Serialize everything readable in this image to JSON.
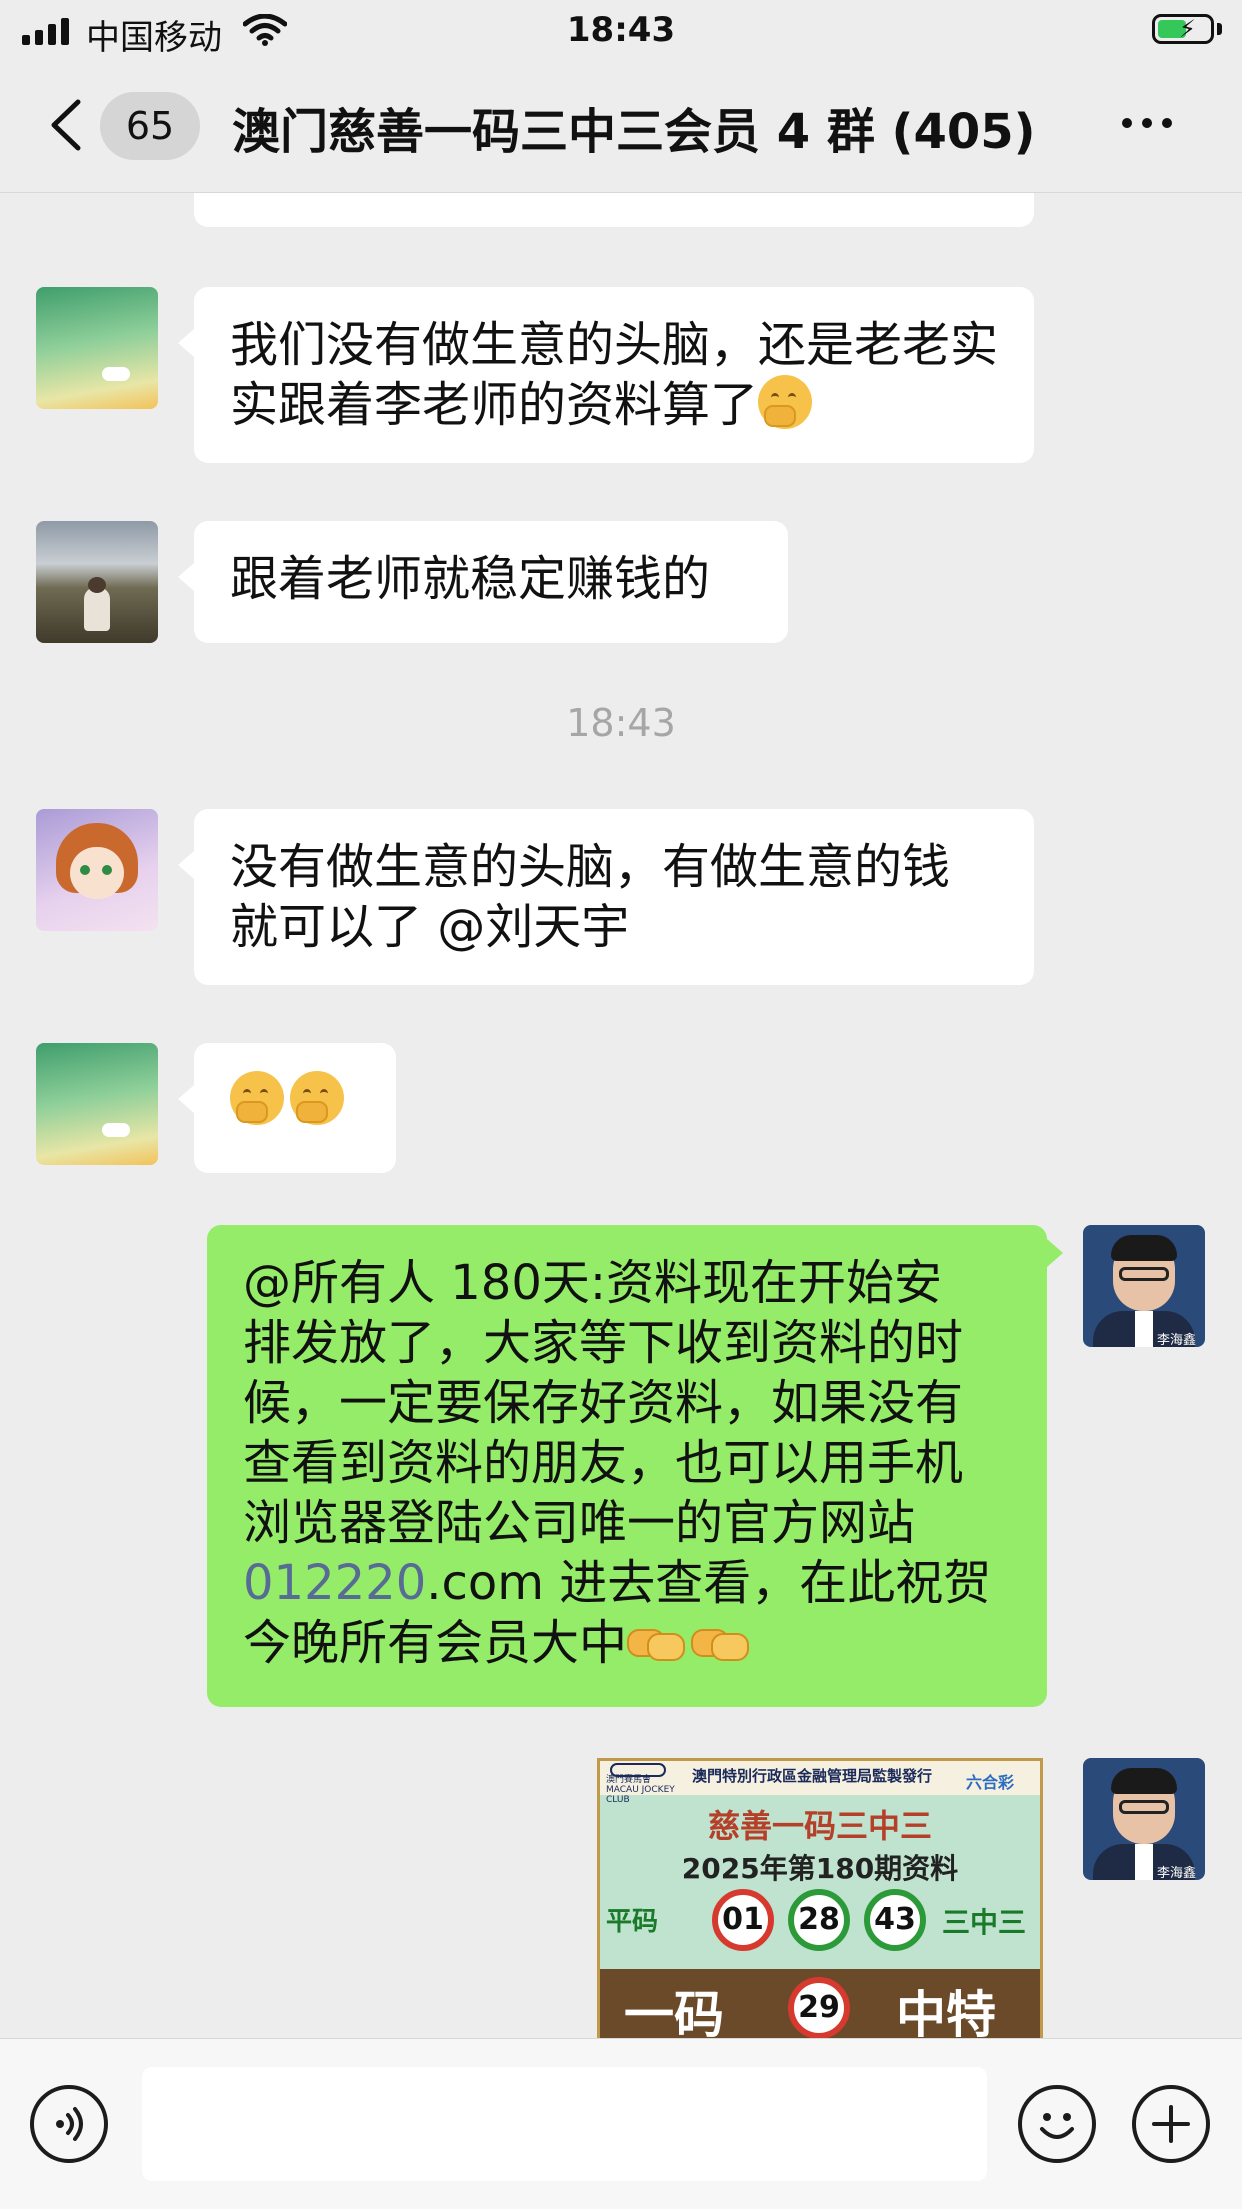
{
  "status_bar": {
    "carrier": "中国移动",
    "time": "18:43"
  },
  "header": {
    "back_count": "65",
    "title": "澳门慈善一码三中三会员 4 群 (405)"
  },
  "messages": {
    "m1": {
      "text": "我们没有做生意的头脑，还是老老实实跟着李老师的资料算了"
    },
    "m2": {
      "text": "跟着老师就稳定赚钱的"
    },
    "timestamp": "18:43",
    "m3": {
      "line1": "没有做生意的头脑，有做生意的钱",
      "line2": "就可以了 @刘天宇"
    },
    "m5": {
      "l1": "@所有人 180天:资料现在开始安",
      "l2": "排发放了，大家等下收到资料的时",
      "l3": "候，一定要保存好资料，如果没有",
      "l4": "查看到资料的朋友，也可以用手机",
      "l5": "浏览器登陆公司唯一的官方网站",
      "link": "012220",
      "l6": ".com 进去查看，在此祝贺",
      "l7": "今晚所有会员大中"
    },
    "avatar_caption": "李海鑫"
  },
  "poster": {
    "issuer": "澳門特別行政區金融管理局監製發行",
    "club": "澳門賽馬會 MACAU JOCKEY CLUB",
    "brand": "六合彩",
    "title": "慈善一码三中三",
    "issue": "2025年第180期资料",
    "left_label": "平码",
    "right_label": "三中三",
    "numbers": [
      "01",
      "28",
      "43"
    ],
    "bottom_left": "一码",
    "special": "29",
    "bottom_right": "中特"
  },
  "colors": {
    "mine_bubble": "#95ec69",
    "link": "#576b95",
    "background": "#ededed"
  }
}
